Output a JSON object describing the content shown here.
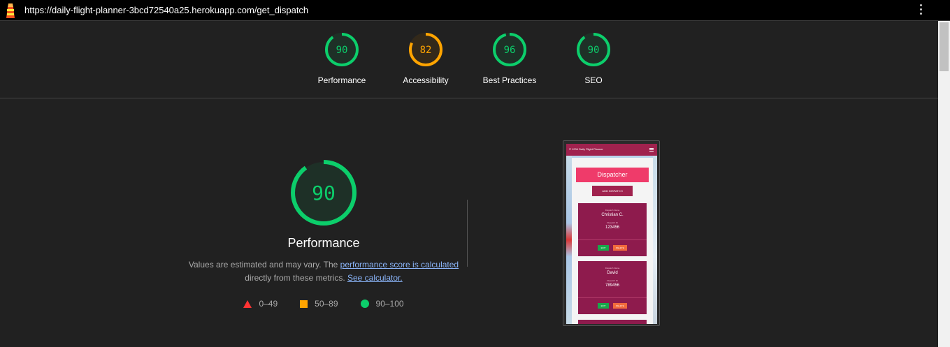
{
  "browser": {
    "url": "https://daily-flight-planner-3bcd72540a25.herokuapp.com/get_dispatch",
    "logo_icon": "lighthouse-icon",
    "menu_icon": "more-vert-icon"
  },
  "colors": {
    "pass": "#0cce6b",
    "average": "#ffa400",
    "fail": "#ff3333"
  },
  "gauges": [
    {
      "label": "Performance",
      "score": "90",
      "status": "pass"
    },
    {
      "label": "Accessibility",
      "score": "82",
      "status": "average"
    },
    {
      "label": "Best Practices",
      "score": "96",
      "status": "pass"
    },
    {
      "label": "SEO",
      "score": "90",
      "status": "pass"
    }
  ],
  "main": {
    "score": "90",
    "title": "Performance",
    "desc_prefix": "Values are estimated and may vary. The ",
    "desc_link1": "performance score is calculated",
    "desc_middle": " directly from these metrics. ",
    "desc_link2": "See calculator.",
    "legend": [
      {
        "shape": "triangle",
        "range": "0–49"
      },
      {
        "shape": "square",
        "range": "50–89"
      },
      {
        "shape": "circle",
        "range": "90–100"
      }
    ]
  },
  "screenshot": {
    "brand": "© 1234 Daily Flight Planner",
    "heading": "Dispatcher",
    "add_button": "ADD DISPATCH",
    "cards": [
      {
        "label_name": "Dispatch Name",
        "name": "Christian C.",
        "label_id": "Dispatch ID",
        "id": "123456",
        "edit": "EDIT",
        "delete": "DELETE"
      },
      {
        "label_name": "Dispatch Name",
        "name": "David",
        "label_id": "Dispatch ID",
        "id": "789456",
        "edit": "EDIT",
        "delete": "DELETE"
      }
    ]
  }
}
